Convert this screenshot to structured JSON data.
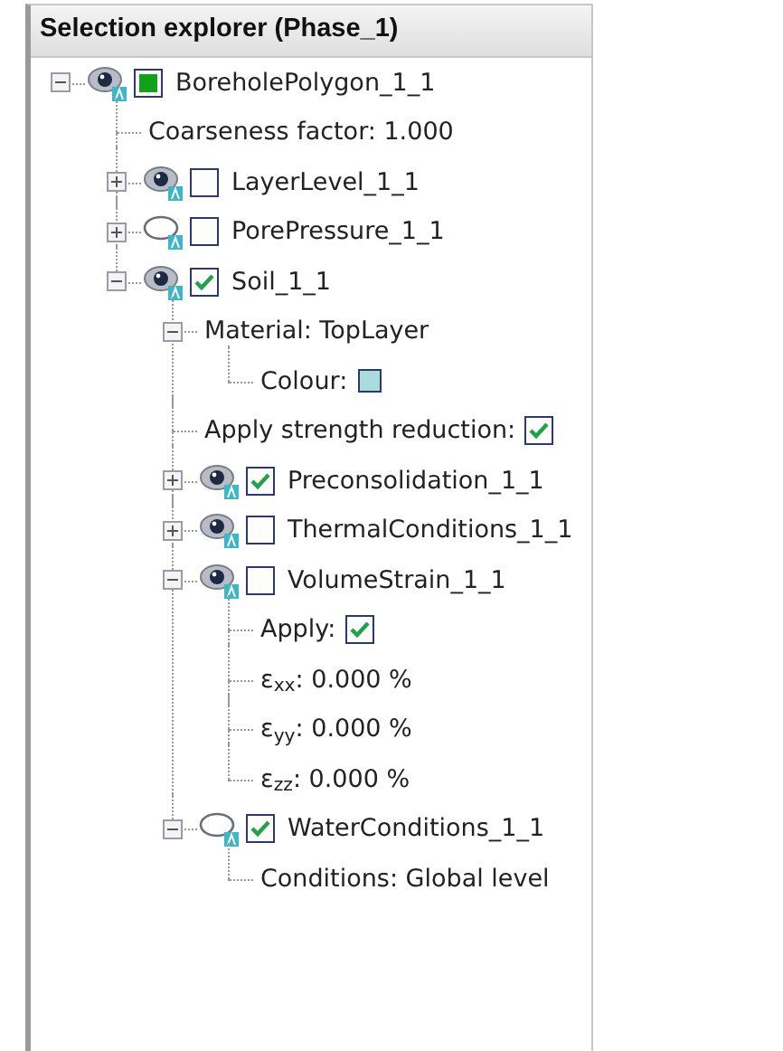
{
  "panel": {
    "title": "Selection explorer (Phase_1)"
  },
  "tree": [
    {
      "kind": "object",
      "label": "BoreholePolygon_1_1",
      "expanded": true,
      "visible": true,
      "partial": true,
      "children": [
        {
          "kind": "text",
          "label": "Coarseness factor: 1.000"
        },
        {
          "kind": "object",
          "label": "LayerLevel_1_1",
          "expanded": false,
          "visible": true,
          "checked": false,
          "partial": false
        },
        {
          "kind": "object",
          "label": "PorePressure_1_1",
          "expanded": false,
          "visible": false,
          "checked": false,
          "partial": false
        },
        {
          "kind": "object",
          "label": "Soil_1_1",
          "expanded": true,
          "visible": true,
          "checked": true,
          "partial": false,
          "children": [
            {
              "kind": "group",
              "label": "Material: TopLayer",
              "expanded": true,
              "children": [
                {
                  "kind": "colour",
                  "label": "Colour:",
                  "color": "#a9dcdc"
                }
              ]
            },
            {
              "kind": "boolean",
              "label": "Apply strength reduction:",
              "checked": true
            },
            {
              "kind": "object",
              "label": "Preconsolidation_1_1",
              "expanded": false,
              "visible": true,
              "checked": true,
              "partial": false
            },
            {
              "kind": "object",
              "label": "ThermalConditions_1_1",
              "expanded": false,
              "visible": true,
              "checked": false,
              "partial": false
            },
            {
              "kind": "object",
              "label": "VolumeStrain_1_1",
              "expanded": true,
              "visible": true,
              "checked": false,
              "partial": false,
              "children": [
                {
                  "kind": "boolean",
                  "label": "Apply:",
                  "checked": true
                },
                {
                  "kind": "text",
                  "label": "ε$_{xx}$: 0.000 %"
                },
                {
                  "kind": "text",
                  "label": "ε$_{yy}$: 0.000 %"
                },
                {
                  "kind": "text",
                  "label": "ε$_{zz}$: 0.000 %"
                }
              ]
            },
            {
              "kind": "object",
              "label": "WaterConditions_1_1",
              "expanded": true,
              "visible": false,
              "checked": true,
              "partial": false,
              "children": [
                {
                  "kind": "text",
                  "label": "Conditions: Global level"
                }
              ]
            }
          ]
        }
      ]
    }
  ]
}
